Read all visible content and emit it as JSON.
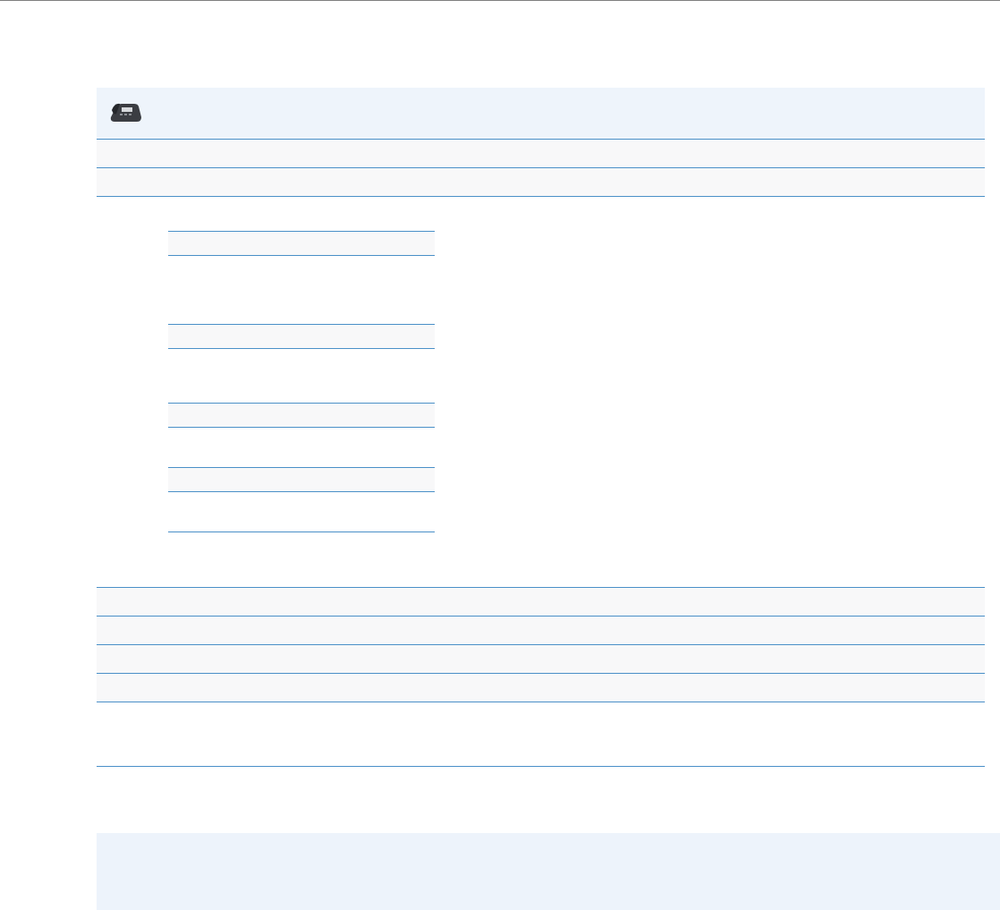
{
  "header": {
    "icon": "desk-phone-icon",
    "title": ""
  },
  "colors": {
    "rule": "#4a90c8",
    "header_band": "#eef4fb",
    "bottom_panel": "#edf3fb",
    "top_rule": "#7f7f7f"
  }
}
